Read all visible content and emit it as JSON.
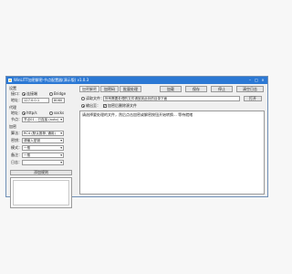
{
  "window": {
    "title": "WinLITT加密解密-节点配置器(演示版) v1.0.3",
    "controls": [
      "–",
      "□",
      "×"
    ]
  },
  "left": {
    "group1_label": "设置",
    "port_label": "接口：",
    "port_options": [
      "连接端",
      "Bridge"
    ],
    "addr_label": "地址：",
    "addr_value": "127.0.0.1",
    "addr_port_value": "8080",
    "group2_label": "代理",
    "proxy_label": "地址：",
    "proxy_options": [
      "http/s",
      "socks"
    ],
    "node_label": "节点：",
    "node_value": "节点01 - 已连接 (auto)",
    "group3_label": "加密",
    "fields": [
      {
        "label": "算法：",
        "value": "RC4 (默认推荐, 通用)"
      },
      {
        "label": "密钥：",
        "value": "请输入密钥"
      },
      {
        "label": "模式：",
        "value": "一般"
      },
      {
        "label": "备注：",
        "value": "一般"
      },
      {
        "label": "日志：",
        "value": ""
      }
    ],
    "add_button": "添加规则"
  },
  "right": {
    "tabs": [
      "加密解密",
      "加密码",
      "批量处理"
    ],
    "buttons": [
      "加载",
      "保存",
      "停止",
      "清空日志"
    ],
    "option1_label": "读取文件：",
    "option1_value": "所有需要处理的文件请放到此处的目录下面",
    "option1_button": "打开",
    "option2_label": "输出至：",
    "option2_extra": "加密后删除源文件",
    "output_line": "请选择要处理的文件，然后点击加密或解密按钮开始转换... 等待就绪"
  }
}
